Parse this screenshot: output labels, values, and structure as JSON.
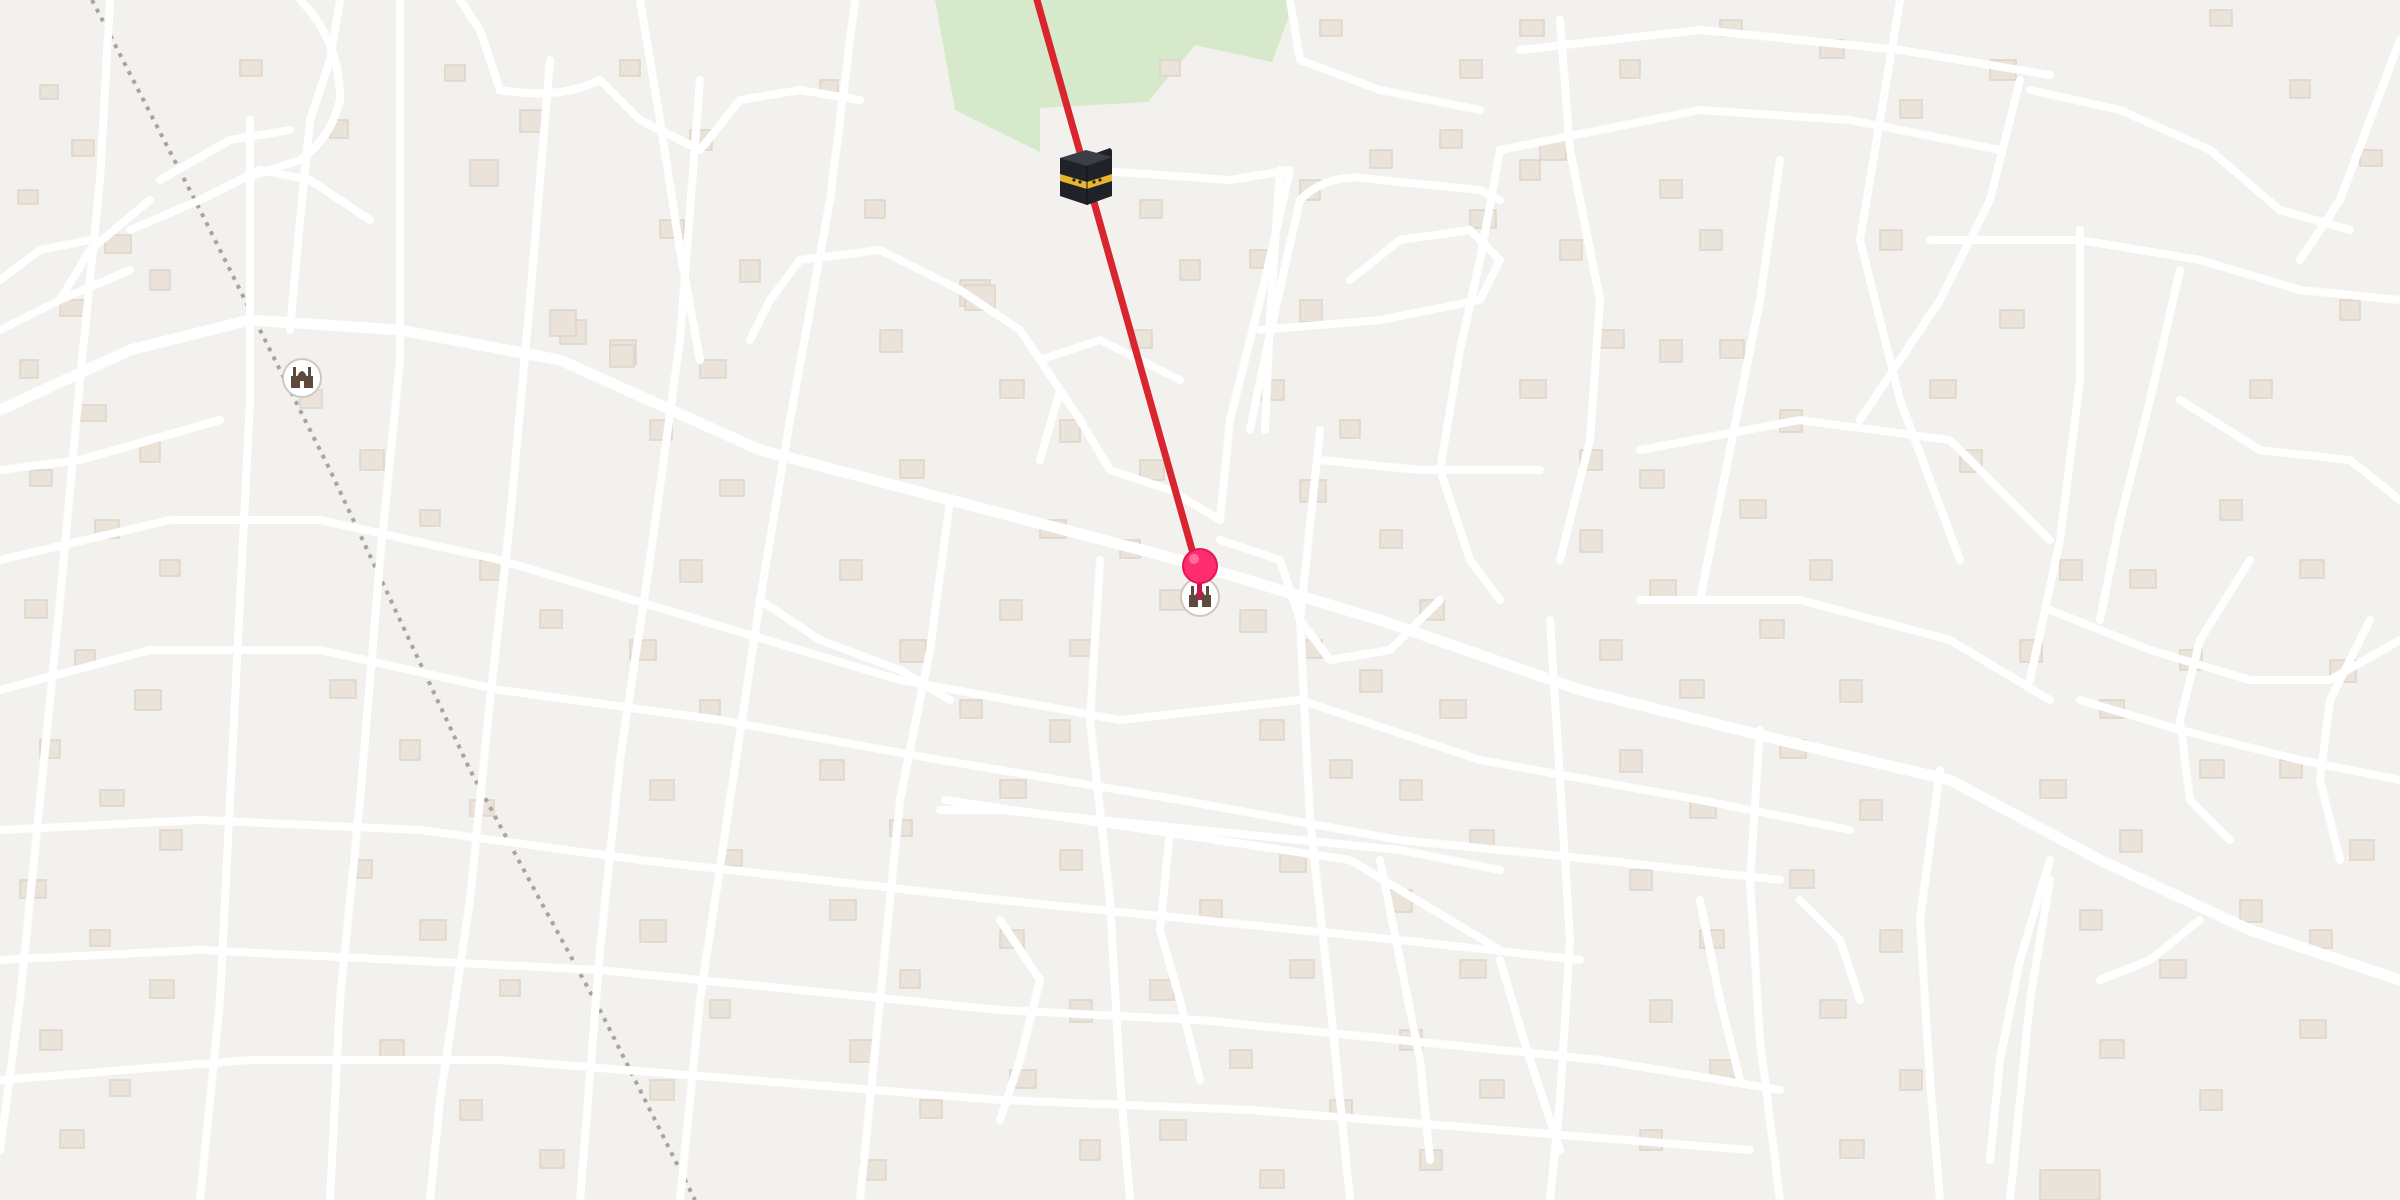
{
  "map": {
    "kind": "street-map",
    "features": {
      "park": "park-area",
      "qibla_line": "qibla-direction-line",
      "rail": "railway-line"
    },
    "markers": [
      {
        "id": "kaaba",
        "icon": "kaaba-icon"
      },
      {
        "id": "current-location",
        "icon": "location-pin-icon",
        "color": "#ff2d6f"
      },
      {
        "id": "mosque-near-pin",
        "icon": "mosque-icon"
      },
      {
        "id": "mosque-west",
        "icon": "mosque-icon"
      }
    ],
    "colors": {
      "background": "#f3f1ed",
      "road": "#ffffff",
      "building": "#e9e3da",
      "park": "#d7e9cb",
      "qibla_line": "#d8252e",
      "pin": "#ff2d6f",
      "kaaba_gold": "#e8b531"
    }
  }
}
